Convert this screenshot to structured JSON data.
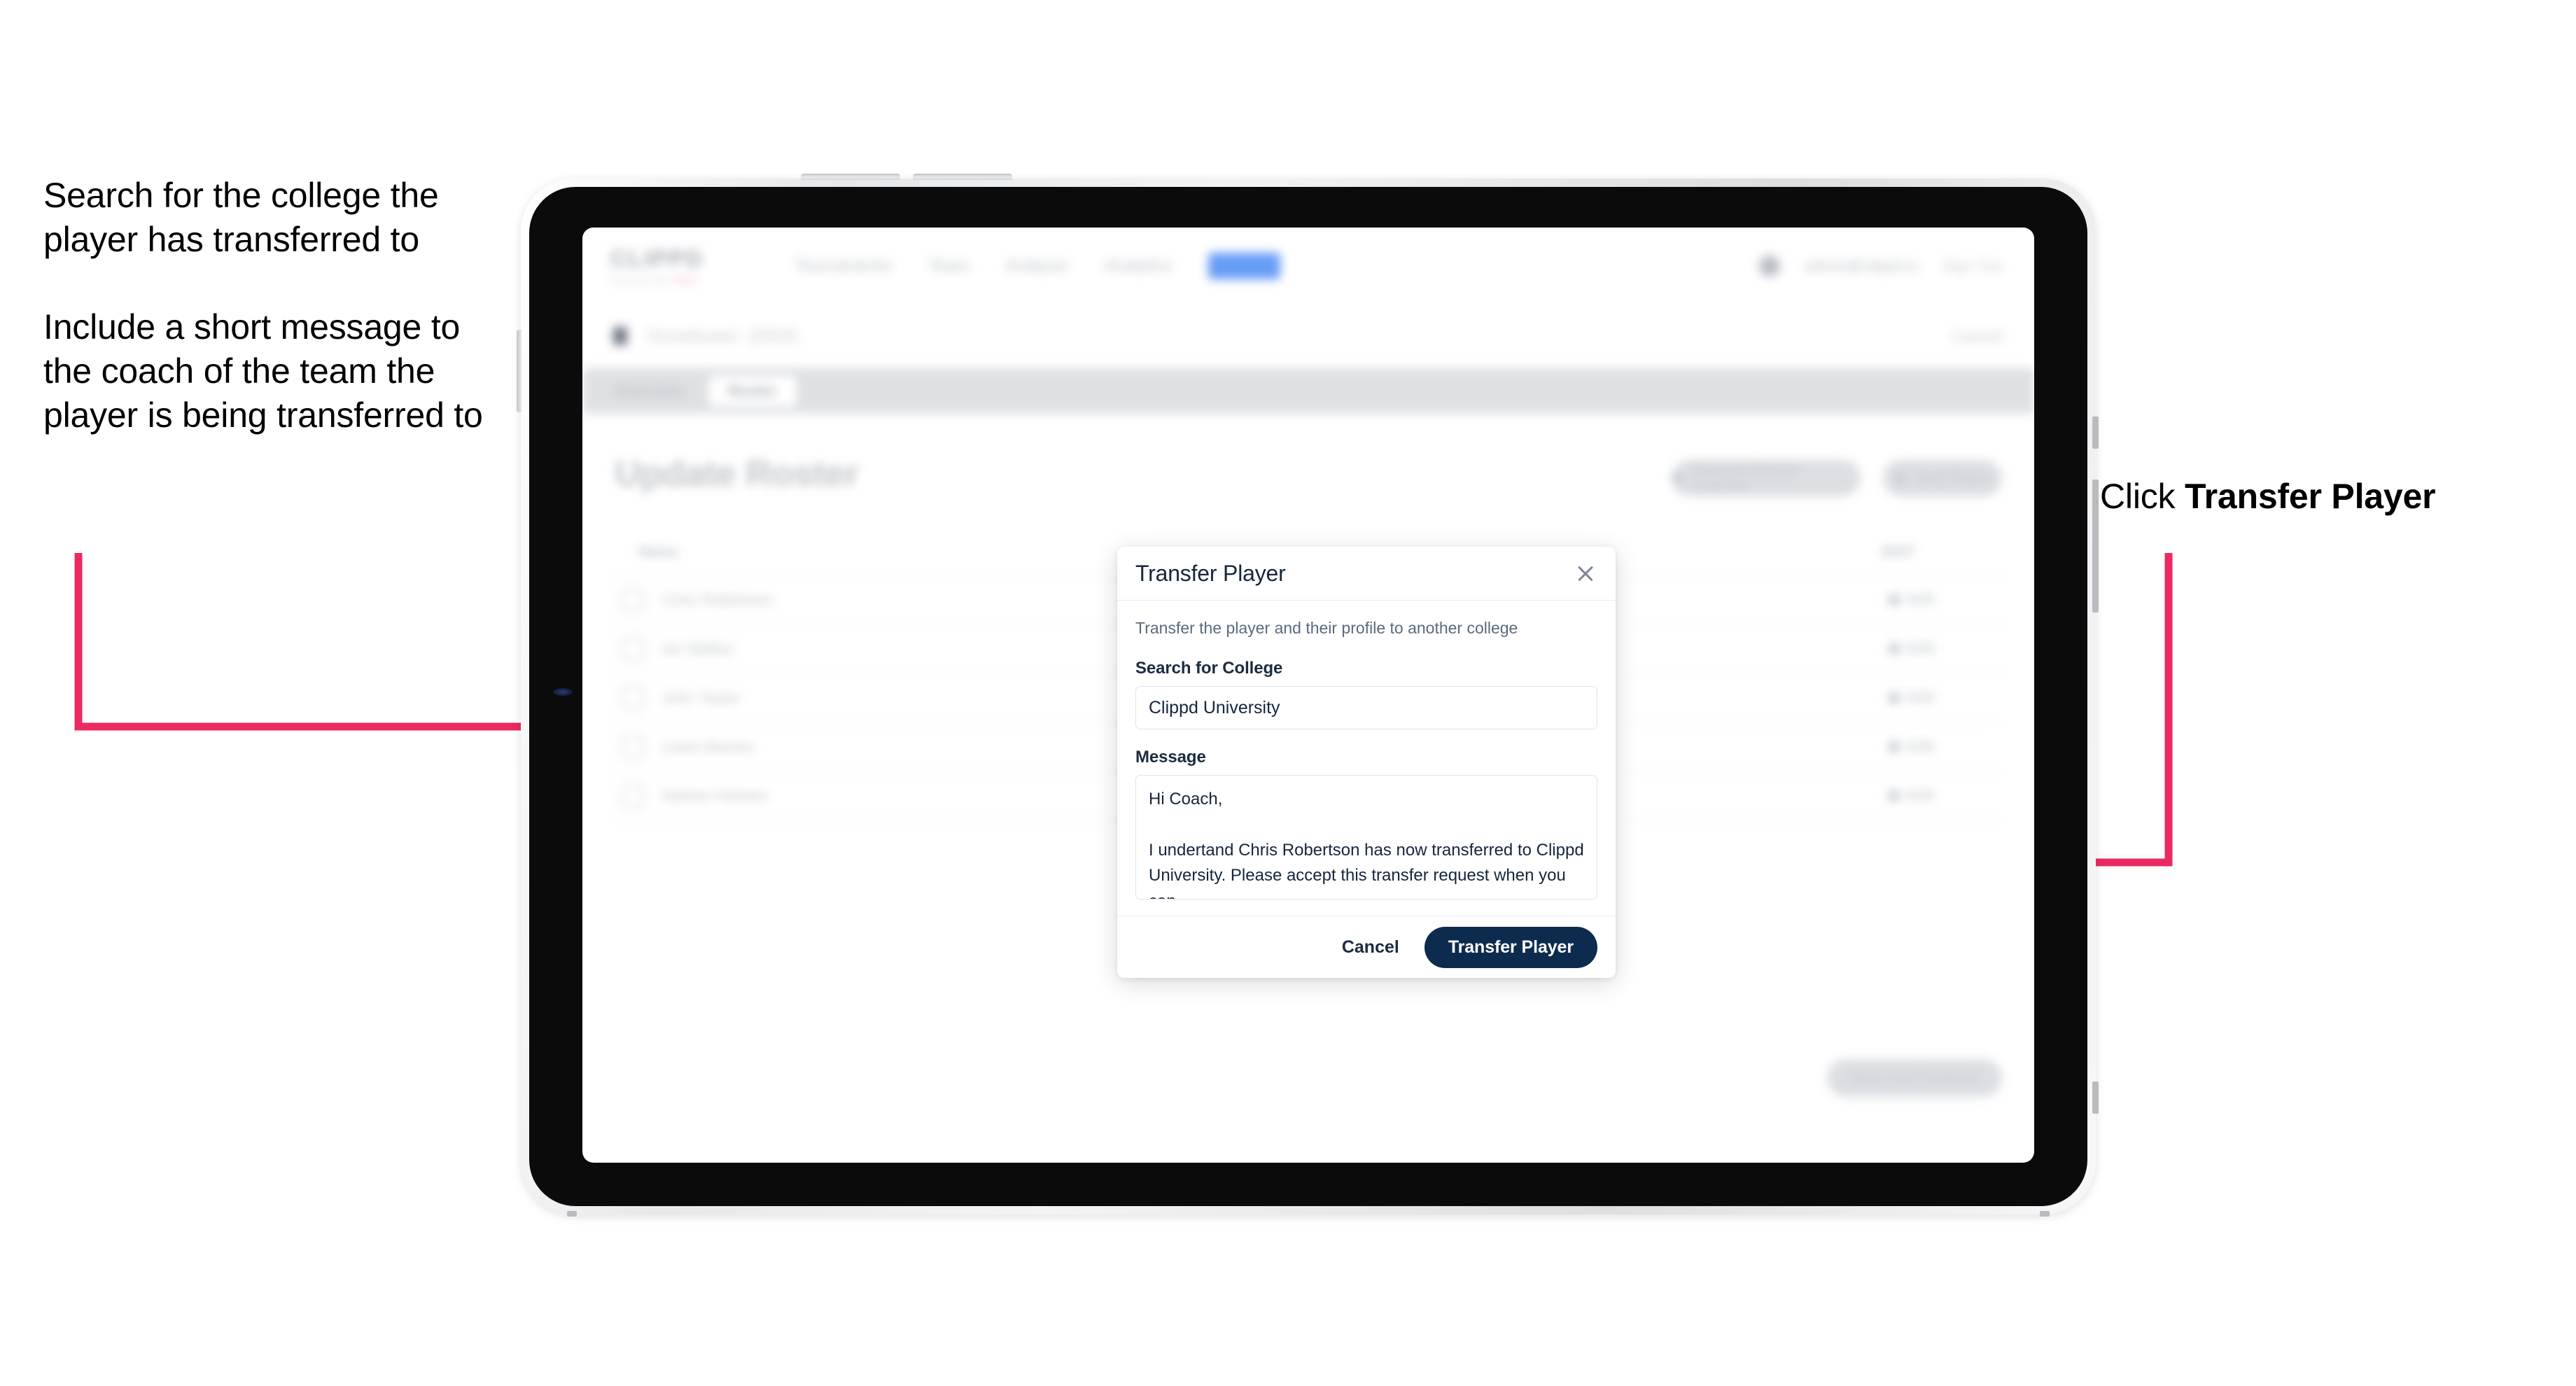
{
  "annotations": {
    "left": {
      "paragraph1": "Search for the college the player has transferred to",
      "paragraph2": "Include a short message to the coach of the team the player is being transferred to"
    },
    "right": {
      "prefix": "Click ",
      "emphasis": "Transfer Player"
    },
    "arrow_color": "#ec2a62"
  },
  "device": {
    "type": "tablet",
    "frame_color": "#e7e8ea",
    "bezel_color": "#0b0b0b"
  },
  "app": {
    "topnav": {
      "brand": "CLIPPD",
      "brand_sub": "Powered by",
      "brand_sub_badge": "PGA",
      "items": [
        {
          "label": "Tournaments"
        },
        {
          "label": "Team"
        },
        {
          "label": "Analysis"
        },
        {
          "label": "Analytics"
        },
        {
          "label": "Roster"
        }
      ],
      "user": "admin@clippd.io",
      "sign_out": "Sign Out"
    },
    "subnav": {
      "title": "Scoreboard",
      "subtitle": "(2024)",
      "cancel": "Cancel"
    },
    "tabs": [
      {
        "label": "Overview",
        "active": false
      },
      {
        "label": "Roster",
        "active": true
      }
    ],
    "page_title": "Update Roster",
    "header_actions": [
      {
        "label": "Request Roster Transfer"
      },
      {
        "label": "Add Player"
      }
    ],
    "roster": {
      "columns": [
        "Name",
        "EDIT"
      ],
      "rows": [
        {
          "name": "Chris Robertson",
          "edit": "Edit"
        },
        {
          "name": "Ian Walker",
          "edit": "Edit"
        },
        {
          "name": "John Taylor",
          "edit": "Edit"
        },
        {
          "name": "Lewis Barnes",
          "edit": "Edit"
        },
        {
          "name": "Nathan Holmes",
          "edit": "Edit"
        }
      ]
    },
    "bottom_cta": "Save And Continue"
  },
  "modal": {
    "title": "Transfer Player",
    "close_label": "Close",
    "description": "Transfer the player and their profile to another college",
    "college_field": {
      "label": "Search for College",
      "value": "Clippd University",
      "placeholder": "Search for College"
    },
    "message_field": {
      "label": "Message",
      "value": "Hi Coach,\n\nI undertand Chris Robertson has now transferred to Clippd University. Please accept this transfer request when you can.",
      "placeholder": "Message"
    },
    "cancel_label": "Cancel",
    "submit_label": "Transfer Player",
    "primary_color": "#0d2b4e"
  }
}
